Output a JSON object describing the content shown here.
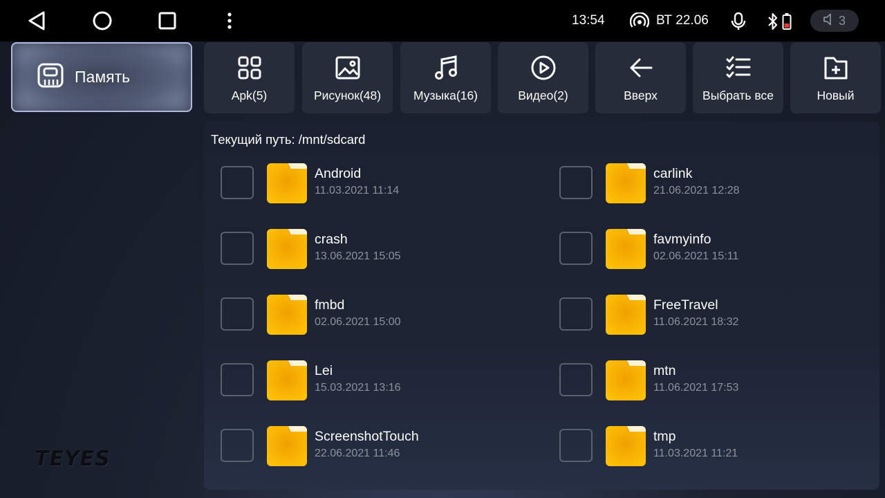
{
  "status_bar": {
    "time": "13:54",
    "date": "ВТ 22.06",
    "volume": "3",
    "icons": [
      "back-icon",
      "home-icon",
      "recents-icon",
      "more-icon",
      "hotspot-icon",
      "mic-icon",
      "bluetooth-icon",
      "battery-icon",
      "volume-icon"
    ]
  },
  "sidebar": {
    "storage_label": "Память",
    "storage_icon": "sd-card-icon",
    "logo": "TEYES"
  },
  "toolbar": {
    "items": [
      {
        "label": "Apk(5)",
        "icon": "apps-grid-icon"
      },
      {
        "label": "Рисунок(48)",
        "icon": "image-icon"
      },
      {
        "label": "Музыка(16)",
        "icon": "music-icon"
      },
      {
        "label": "Видео(2)",
        "icon": "play-icon"
      },
      {
        "label": "Вверх",
        "icon": "arrow-left-icon"
      },
      {
        "label": "Выбрать все",
        "icon": "checklist-icon"
      },
      {
        "label": "Новый",
        "icon": "new-folder-icon"
      }
    ]
  },
  "browser": {
    "current_path": "Текущий путь: /mnt/sdcard",
    "files": [
      {
        "name": "Android",
        "date": "11.03.2021 11:14"
      },
      {
        "name": "carlink",
        "date": "21.06.2021 12:28"
      },
      {
        "name": "crash",
        "date": "13.06.2021 15:05"
      },
      {
        "name": "favmyinfo",
        "date": "02.06.2021 15:11"
      },
      {
        "name": "fmbd",
        "date": "02.06.2021 15:00"
      },
      {
        "name": "FreeTravel",
        "date": "11.06.2021 18:32"
      },
      {
        "name": "Lei",
        "date": "15.03.2021 13:16"
      },
      {
        "name": "mtn",
        "date": "11.06.2021 17:53"
      },
      {
        "name": "ScreenshotTouch",
        "date": "22.06.2021 11:46"
      },
      {
        "name": "tmp",
        "date": "11.03.2021 11:21"
      }
    ]
  },
  "colors": {
    "folder": "#f5a800",
    "panel": "#1d2434",
    "toolbar_button": "#262c39"
  }
}
